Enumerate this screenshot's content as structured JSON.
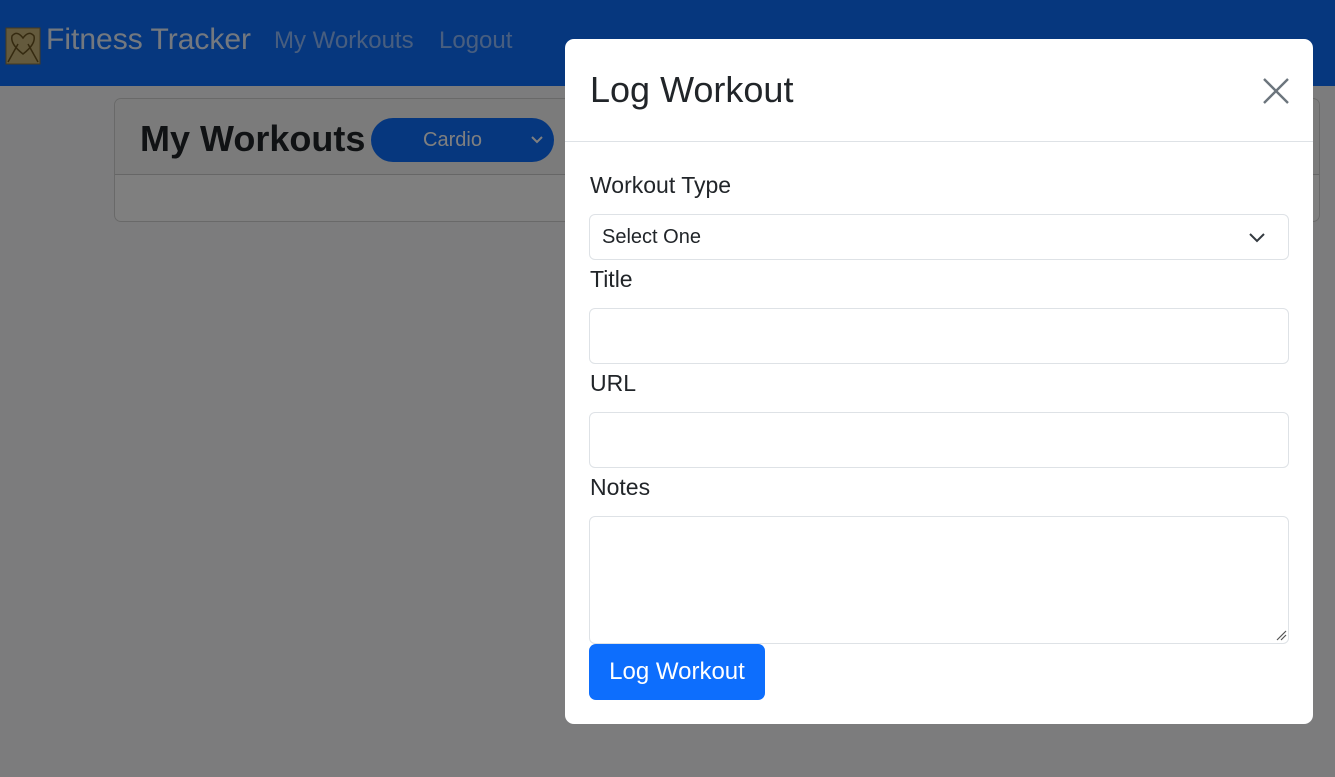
{
  "navbar": {
    "brand": "Fitness Tracker",
    "links": [
      "My Workouts",
      "Logout"
    ],
    "brand_logo_icon": "fitness-logo-icon"
  },
  "page": {
    "title": "My Workouts",
    "filter_value": "Cardio"
  },
  "modal": {
    "title": "Log Workout",
    "fields": {
      "workout_type_label": "Workout Type",
      "workout_type_value": "Select One",
      "title_label": "Title",
      "title_value": "",
      "url_label": "URL",
      "url_value": "",
      "notes_label": "Notes",
      "notes_value": ""
    },
    "submit_label": "Log Workout"
  },
  "colors": {
    "primary": "#0d6efd",
    "backdrop": "rgba(0,0,0,0.5)"
  }
}
